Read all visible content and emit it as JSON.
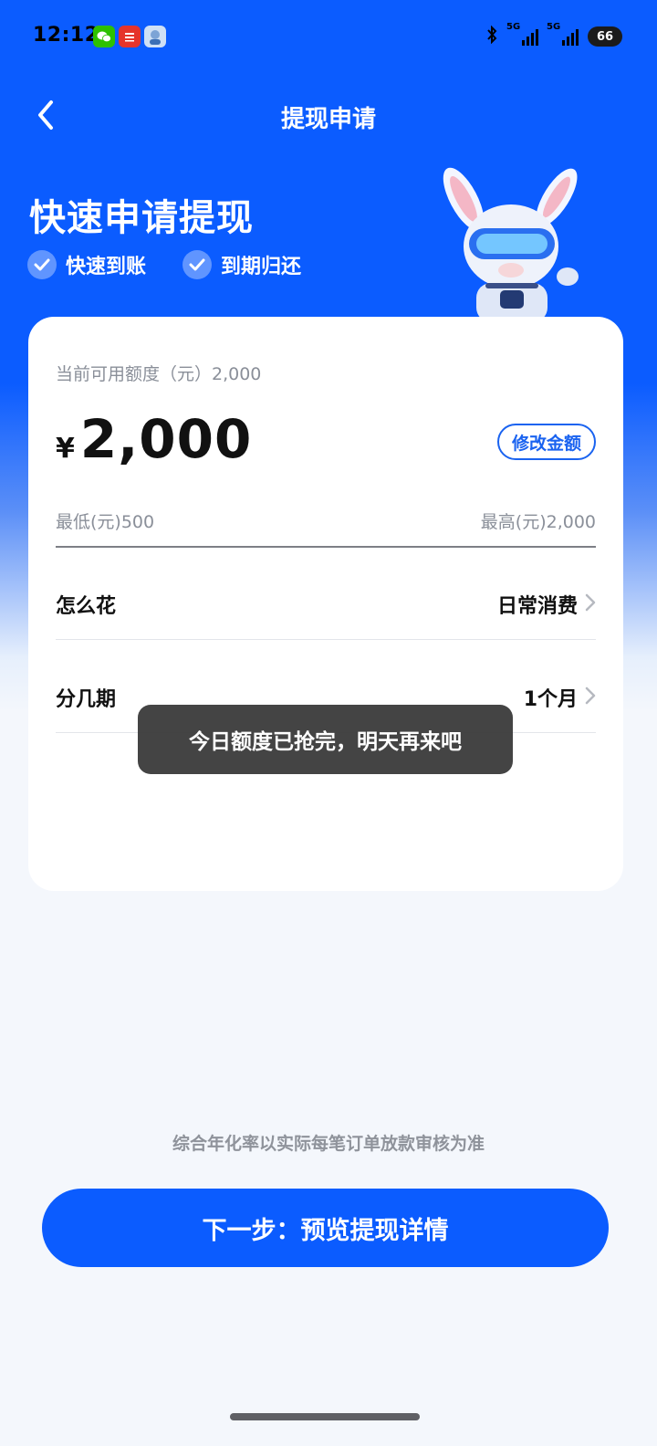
{
  "status_bar": {
    "time": "12:12",
    "apps": [
      "wechat-icon",
      "bank-app-icon",
      "avatar-app-icon"
    ],
    "network_1": "5G",
    "network_2": "5G",
    "battery": "66"
  },
  "nav": {
    "title": "提现申请"
  },
  "hero": {
    "title": "快速申请提现",
    "benefits": [
      "快速到账",
      "到期归还"
    ]
  },
  "card": {
    "limit_label": "当前可用额度（元）2,000",
    "currency_symbol": "¥",
    "amount": "2,000",
    "edit_button": "修改金额",
    "min_label": "最低(元)500",
    "max_label": "最高(元)2,000",
    "rows": [
      {
        "label": "怎么花",
        "value": "日常消费"
      },
      {
        "label": "分几期",
        "value": "1个月"
      }
    ]
  },
  "toast": "今日额度已抢完，明天再来吧",
  "footnote": "综合年化率以实际每笔订单放款审核为准",
  "next_button": "下一步：预览提现详情",
  "colors": {
    "primary": "#0b5cff",
    "background": "#f4f7fc"
  }
}
